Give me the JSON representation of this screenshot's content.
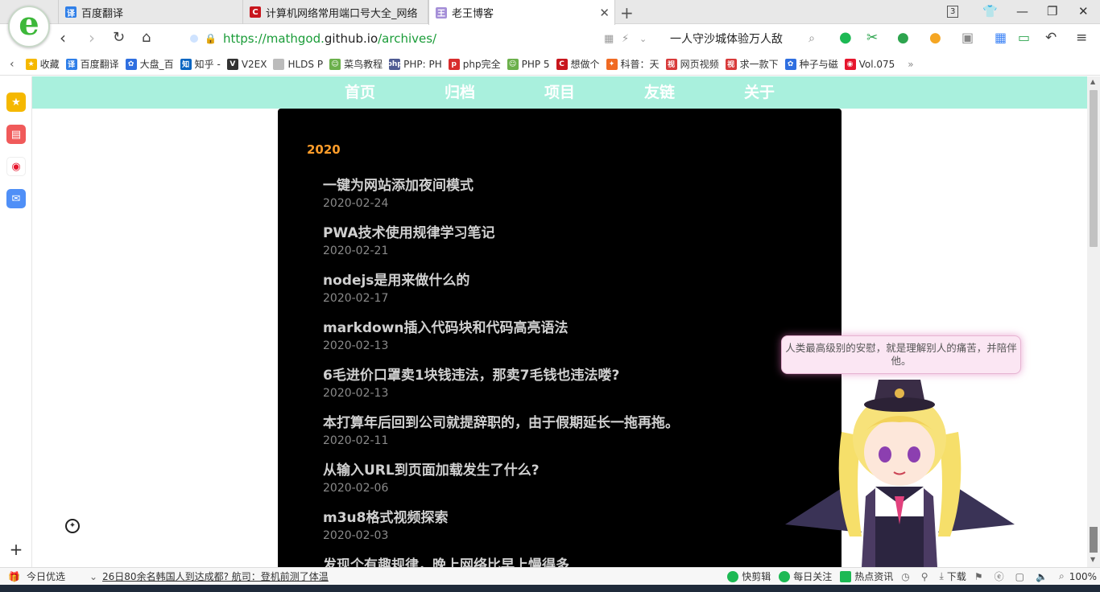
{
  "browser": {
    "tabs": [
      {
        "label": "百度翻译",
        "icon": "baidu-translate-icon",
        "color": "#2f7fe8",
        "glyph": "译"
      },
      {
        "label": "计算机网络常用端口号大全_网络",
        "icon": "csdn-icon",
        "color": "#c8161d",
        "glyph": "C"
      },
      {
        "label": "老王博客",
        "icon": "blog-favicon-icon",
        "color": "#a58fd8",
        "glyph": "王"
      }
    ],
    "tab_badge": "3",
    "url": {
      "prefix": "https://mathgod.",
      "domain": "github.io",
      "path": "/archives/"
    },
    "search_text": "一人守沙城体验万人敌",
    "bookmarks": [
      {
        "label": "收藏",
        "icon": "star-icon",
        "color": "#f5b800",
        "glyph": "★"
      },
      {
        "label": "百度翻译",
        "icon": "baidu-translate-icon",
        "color": "#2f7fe8",
        "glyph": "译"
      },
      {
        "label": "大盘_百",
        "icon": "baidu-paw-icon",
        "color": "#2f6fe0",
        "glyph": "✿"
      },
      {
        "label": "知乎 -",
        "icon": "zhihu-icon",
        "color": "#0a66c2",
        "glyph": "知"
      },
      {
        "label": "V2EX",
        "icon": "v2ex-icon",
        "color": "#333333",
        "glyph": "V"
      },
      {
        "label": "HLDS P",
        "icon": "page-icon",
        "color": "#bbbbbb",
        "glyph": ""
      },
      {
        "label": "菜鸟教程",
        "icon": "runoob-icon",
        "color": "#6bb04b",
        "glyph": "☺"
      },
      {
        "label": "PHP: PH",
        "icon": "php-icon",
        "color": "#4f5b93",
        "glyph": "php"
      },
      {
        "label": "php完全",
        "icon": "php-red-icon",
        "color": "#d82d2d",
        "glyph": "p"
      },
      {
        "label": "PHP 5",
        "icon": "runoob-icon",
        "color": "#6bb04b",
        "glyph": "☺"
      },
      {
        "label": "想做个",
        "icon": "csdn-icon",
        "color": "#c8161d",
        "glyph": "C"
      },
      {
        "label": "科普：天",
        "icon": "fire-icon",
        "color": "#f06a23",
        "glyph": "✦"
      },
      {
        "label": "网页视频",
        "icon": "video-icon",
        "color": "#d83a3a",
        "glyph": "视"
      },
      {
        "label": "求一款下",
        "icon": "video-icon",
        "color": "#d83a3a",
        "glyph": "视"
      },
      {
        "label": "种子与磁",
        "icon": "baidu-paw-icon",
        "color": "#2f6fe0",
        "glyph": "✿"
      },
      {
        "label": "Vol.075",
        "icon": "weibo-icon",
        "color": "#e6162d",
        "glyph": "◉"
      }
    ]
  },
  "site": {
    "nav": [
      "首页",
      "归档",
      "项目",
      "友链",
      "关于"
    ],
    "year": "2020",
    "posts": [
      {
        "title": "一键为网站添加夜间模式",
        "date": "2020-02-24"
      },
      {
        "title": "PWA技术使用规律学习笔记",
        "date": "2020-02-21"
      },
      {
        "title": "nodejs是用来做什么的",
        "date": "2020-02-17"
      },
      {
        "title": "markdown插入代码块和代码高亮语法",
        "date": "2020-02-13"
      },
      {
        "title": "6毛进价口罩卖1块钱违法，那卖7毛钱也违法喽?",
        "date": "2020-02-13"
      },
      {
        "title": "本打算年后回到公司就提辞职的，由于假期延长一拖再拖。",
        "date": "2020-02-11"
      },
      {
        "title": "从输入URL到页面加载发生了什么?",
        "date": "2020-02-06"
      },
      {
        "title": "m3u8格式视频探索",
        "date": "2020-02-03"
      },
      {
        "title": "发现个有趣规律，晚上网络比早上慢得多",
        "date": ""
      }
    ],
    "mascot_message": "人类最高级别的安慰，就是理解别人的痛苦，并陪伴他。"
  },
  "statusbar": {
    "today": "今日优选",
    "headline": "26日80余名韩国人到达成都? 航司：登机前测了体温",
    "quick_clip": "快剪辑",
    "daily_follow": "每日关注",
    "hot_news": "热点资讯",
    "download": "下载",
    "zoom": "100%"
  },
  "colors": {
    "accent_nav": "#a9f0dd",
    "year": "#ff9d2a",
    "url_green": "#1a9c38"
  }
}
